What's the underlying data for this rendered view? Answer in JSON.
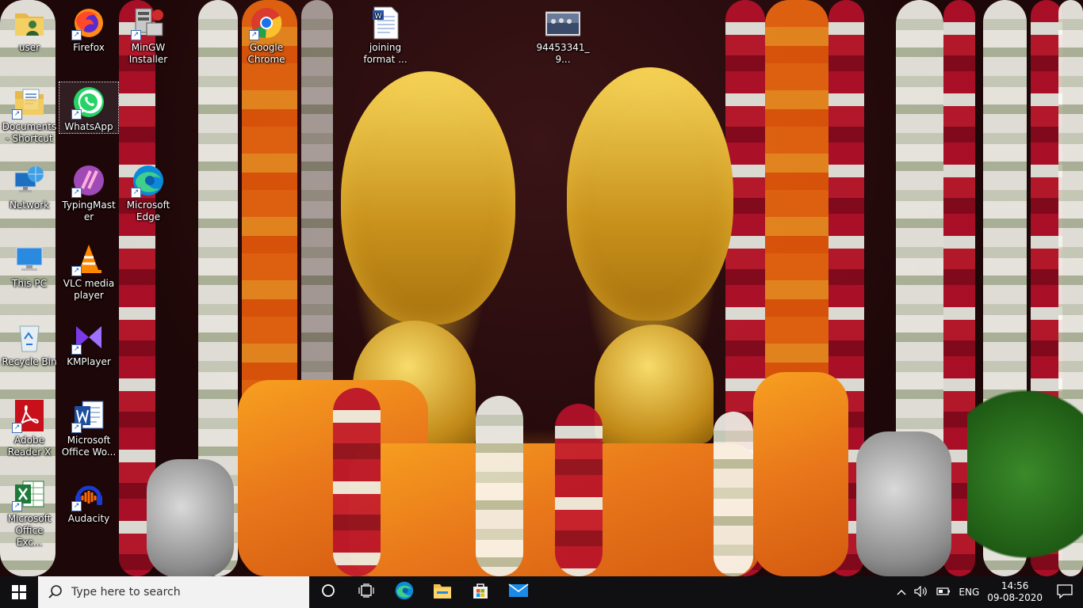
{
  "desktop": {
    "icons": [
      {
        "label": "user",
        "icon": "user-folder-icon"
      },
      {
        "label": "Firefox",
        "icon": "firefox-icon"
      },
      {
        "label": "MinGW Installer",
        "icon": "mingw-installer-icon"
      },
      {
        "label": "Google Chrome",
        "icon": "chrome-icon"
      },
      {
        "label": "joining format ...",
        "icon": "word-document-icon"
      },
      {
        "label": "94453341_9...",
        "icon": "image-file-icon"
      },
      {
        "label": "Documents - Shortcut",
        "icon": "documents-folder-icon"
      },
      {
        "label": "WhatsApp",
        "icon": "whatsapp-icon"
      },
      {
        "label": "Network",
        "icon": "network-icon"
      },
      {
        "label": "TypingMaster",
        "icon": "typingmaster-icon"
      },
      {
        "label": "Microsoft Edge",
        "icon": "edge-icon"
      },
      {
        "label": "This PC",
        "icon": "this-pc-icon"
      },
      {
        "label": "VLC media player",
        "icon": "vlc-icon"
      },
      {
        "label": "Recycle Bin",
        "icon": "recycle-bin-icon"
      },
      {
        "label": "KMPlayer",
        "icon": "kmplayer-icon"
      },
      {
        "label": "Adobe Reader X",
        "icon": "adobe-reader-icon"
      },
      {
        "label": "Microsoft Office Wo...",
        "icon": "word-icon"
      },
      {
        "label": "Microsoft Office Exc...",
        "icon": "excel-icon"
      },
      {
        "label": "Audacity",
        "icon": "audacity-icon"
      }
    ]
  },
  "taskbar": {
    "search_placeholder": "Type here to search",
    "pinned": [
      "task-view-icon",
      "edge-icon",
      "file-explorer-icon",
      "microsoft-store-icon",
      "mail-icon"
    ],
    "tray": {
      "language": "ENG",
      "time": "14:56",
      "date": "09-08-2020"
    }
  },
  "colors": {
    "taskbar_bg": "#101012",
    "search_bg": "#f2f2f2",
    "accent_blue": "#0078d7"
  }
}
